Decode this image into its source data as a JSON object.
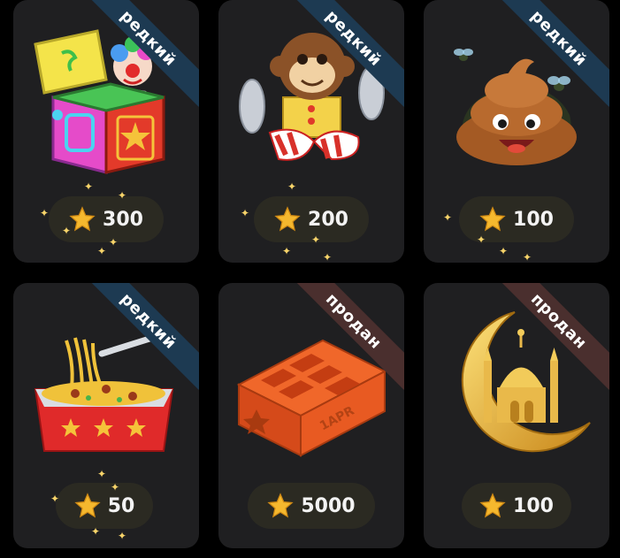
{
  "colors": {
    "card_bg": "#1f1f21",
    "rare_ribbon": "#1d3a52",
    "sold_ribbon": "#4a2f2e",
    "price_pill": "#2b2a22",
    "star": "#f5b82e",
    "page_bg": "#000000"
  },
  "gifts": [
    {
      "item": "jack-in-the-box",
      "icon": "jack-in-the-box-icon",
      "badge": "редкий",
      "badge_type": "rare",
      "price": "300"
    },
    {
      "item": "monkey-with-cymbals",
      "icon": "monkey-cymbals-icon",
      "badge": "редкий",
      "badge_type": "rare",
      "price": "200"
    },
    {
      "item": "poop",
      "icon": "poop-icon",
      "badge": "редкий",
      "badge_type": "rare",
      "price": "100"
    },
    {
      "item": "noodles",
      "icon": "noodles-box-icon",
      "badge": "редкий",
      "badge_type": "rare",
      "price": "50"
    },
    {
      "item": "brick",
      "icon": "brick-icon",
      "badge": "продан",
      "badge_type": "sold",
      "price": "5000",
      "brick_text": "1APR"
    },
    {
      "item": "crescent-mosque",
      "icon": "crescent-mosque-icon",
      "badge": "продан",
      "badge_type": "sold",
      "price": "100"
    }
  ]
}
